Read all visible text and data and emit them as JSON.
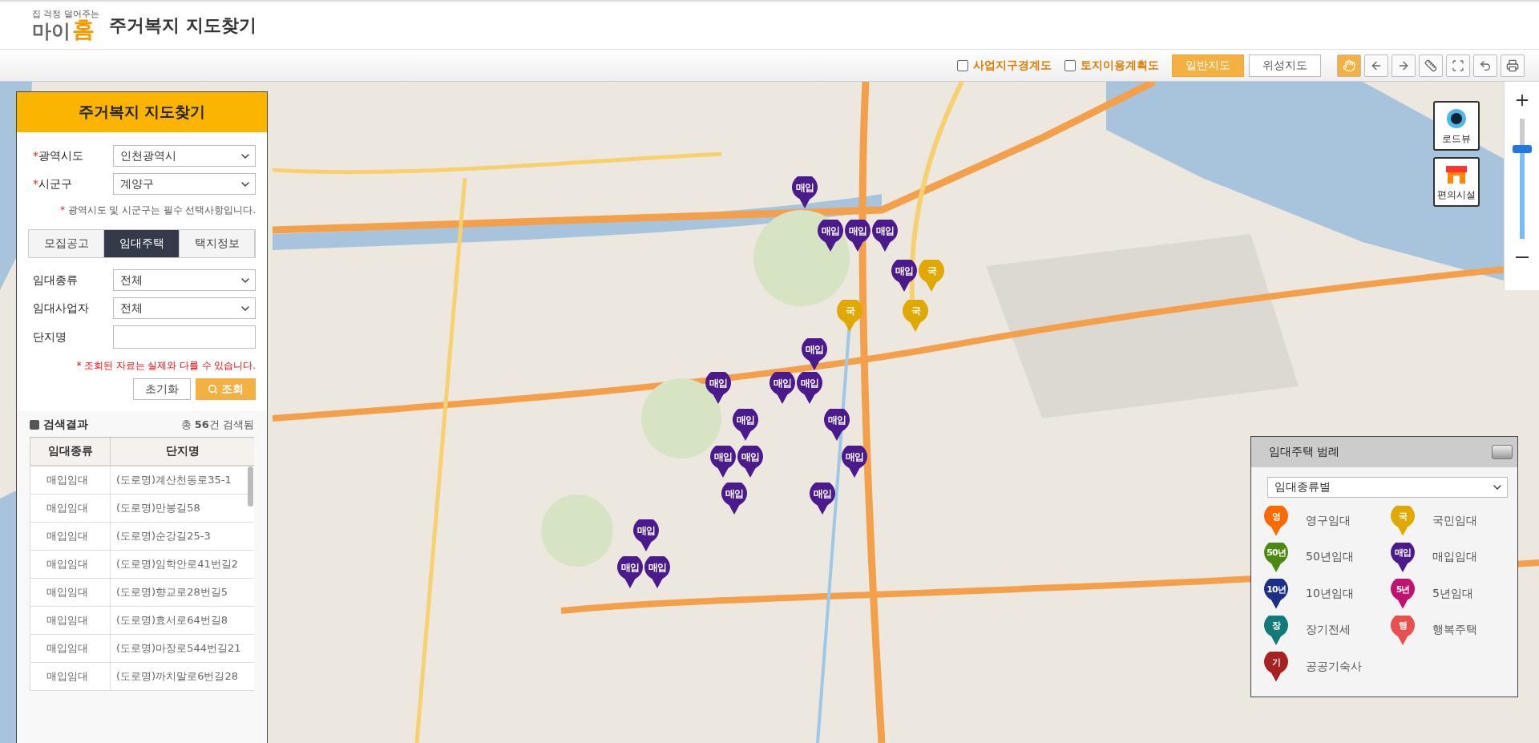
{
  "header": {
    "logo": {
      "tagline": "집 걱정 덜어주는",
      "main": "마이",
      "accent": "홈"
    },
    "title": "주거복지 지도찾기"
  },
  "toolbar": {
    "layers": [
      {
        "label": "사업지구경계도",
        "checked": false
      },
      {
        "label": "토지이용계획도",
        "checked": false
      }
    ],
    "map_types": [
      {
        "label": "일반지도",
        "selected": true
      },
      {
        "label": "위성지도",
        "selected": false
      }
    ],
    "tools": [
      {
        "kind": "hand",
        "selected": true
      },
      {
        "kind": "back",
        "selected": false
      },
      {
        "kind": "forward",
        "selected": false
      },
      {
        "kind": "distance",
        "selected": false
      },
      {
        "kind": "area",
        "selected": false
      },
      {
        "kind": "undo",
        "selected": false
      },
      {
        "kind": "print",
        "selected": false
      }
    ]
  },
  "map_controls": {
    "buttons": [
      {
        "kind": "roadview",
        "label": "로드뷰"
      },
      {
        "kind": "facility",
        "label": "편의시설"
      }
    ],
    "zoom": {
      "level": 0.78
    }
  },
  "map_markers": [
    {
      "label": "매입",
      "color": "#4b1a8c"
    },
    {
      "label": "매입",
      "color": "#4b1a8c"
    },
    {
      "label": "매입",
      "color": "#4b1a8c"
    },
    {
      "label": "매입",
      "color": "#4b1a8c"
    },
    {
      "label": "매입",
      "color": "#4b1a8c"
    },
    {
      "label": "국",
      "color": "#e0a800"
    },
    {
      "label": "국",
      "color": "#e0a800"
    },
    {
      "label": "국",
      "color": "#e0a800"
    },
    {
      "label": "매입",
      "color": "#4b1a8c"
    },
    {
      "label": "매입",
      "color": "#4b1a8c"
    },
    {
      "label": "매입",
      "color": "#4b1a8c"
    },
    {
      "label": "매입",
      "color": "#4b1a8c"
    },
    {
      "label": "매입",
      "color": "#4b1a8c"
    },
    {
      "label": "매입",
      "color": "#4b1a8c"
    },
    {
      "label": "매입",
      "color": "#4b1a8c"
    },
    {
      "label": "매입",
      "color": "#4b1a8c"
    },
    {
      "label": "매입",
      "color": "#4b1a8c"
    },
    {
      "label": "매입",
      "color": "#4b1a8c"
    },
    {
      "label": "매입",
      "color": "#4b1a8c"
    },
    {
      "label": "매입",
      "color": "#4b1a8c"
    },
    {
      "label": "매입",
      "color": "#4b1a8c"
    },
    {
      "label": "매입",
      "color": "#4b1a8c"
    }
  ],
  "panel": {
    "title": "주거복지 지도찾기",
    "selects": [
      {
        "label": "광역시도",
        "required": true,
        "value": "인천광역시"
      },
      {
        "label": "시군구",
        "required": true,
        "value": "계양구"
      }
    ],
    "required_note": {
      "mark": "*",
      "text": "광역시도 및 시군구는 필수 선택사항입니다."
    },
    "tabs": [
      {
        "label": "모집공고",
        "selected": false
      },
      {
        "label": "임대주택",
        "selected": true
      },
      {
        "label": "택지정보",
        "selected": false
      }
    ],
    "filters": [
      {
        "kind": "select",
        "label": "임대종류",
        "value": "전체"
      },
      {
        "kind": "select",
        "label": "임대사업자",
        "value": "전체"
      },
      {
        "kind": "input",
        "label": "단지명"
      }
    ],
    "warning": "* 조회된 자료는 실제와 다를 수 있습니다.",
    "buttons": [
      {
        "kind": "reset",
        "label": "초기화"
      },
      {
        "kind": "search",
        "label": "조회"
      }
    ],
    "results": {
      "heading": "검색결과",
      "count": "총 **56**건 검색됨",
      "columns": [
        "임대종류",
        "단지명"
      ],
      "rows": [
        [
          "매입임대",
          "(도로명)계산천동로35-1"
        ],
        [
          "매입임대",
          "(도로명)만봉길58"
        ],
        [
          "매입임대",
          "(도로명)순강길25-3"
        ],
        [
          "매입임대",
          "(도로명)임학안로41번길2"
        ],
        [
          "매입임대",
          "(도로명)향교로28번길5"
        ],
        [
          "매입임대",
          "(도로명)효서로64번길8"
        ],
        [
          "매입임대",
          "(도로명)마장로544번길21"
        ],
        [
          "매입임대",
          "(도로명)까치말로6번길28"
        ]
      ]
    }
  },
  "legend": {
    "title": "임대주택 범례",
    "select": "임대종류별",
    "items": [
      {
        "badge": "영",
        "label": "영구임대",
        "color": "#ff6a00"
      },
      {
        "badge": "국",
        "label": "국민임대",
        "color": "#e0a800"
      },
      {
        "badge": "50년",
        "label": "50년임대",
        "color": "#4a8a10"
      },
      {
        "badge": "매입",
        "label": "매입임대",
        "color": "#4b1a8c"
      },
      {
        "badge": "10년",
        "label": "10년임대",
        "color": "#1a2f8a"
      },
      {
        "badge": "5년",
        "label": "5년임대",
        "color": "#c0126e"
      },
      {
        "badge": "장",
        "label": "장기전세",
        "color": "#137a7a"
      },
      {
        "badge": "행",
        "label": "행복주택",
        "color": "#e85050"
      },
      {
        "badge": "기",
        "label": "공공기숙사",
        "color": "#a82020"
      }
    ]
  }
}
